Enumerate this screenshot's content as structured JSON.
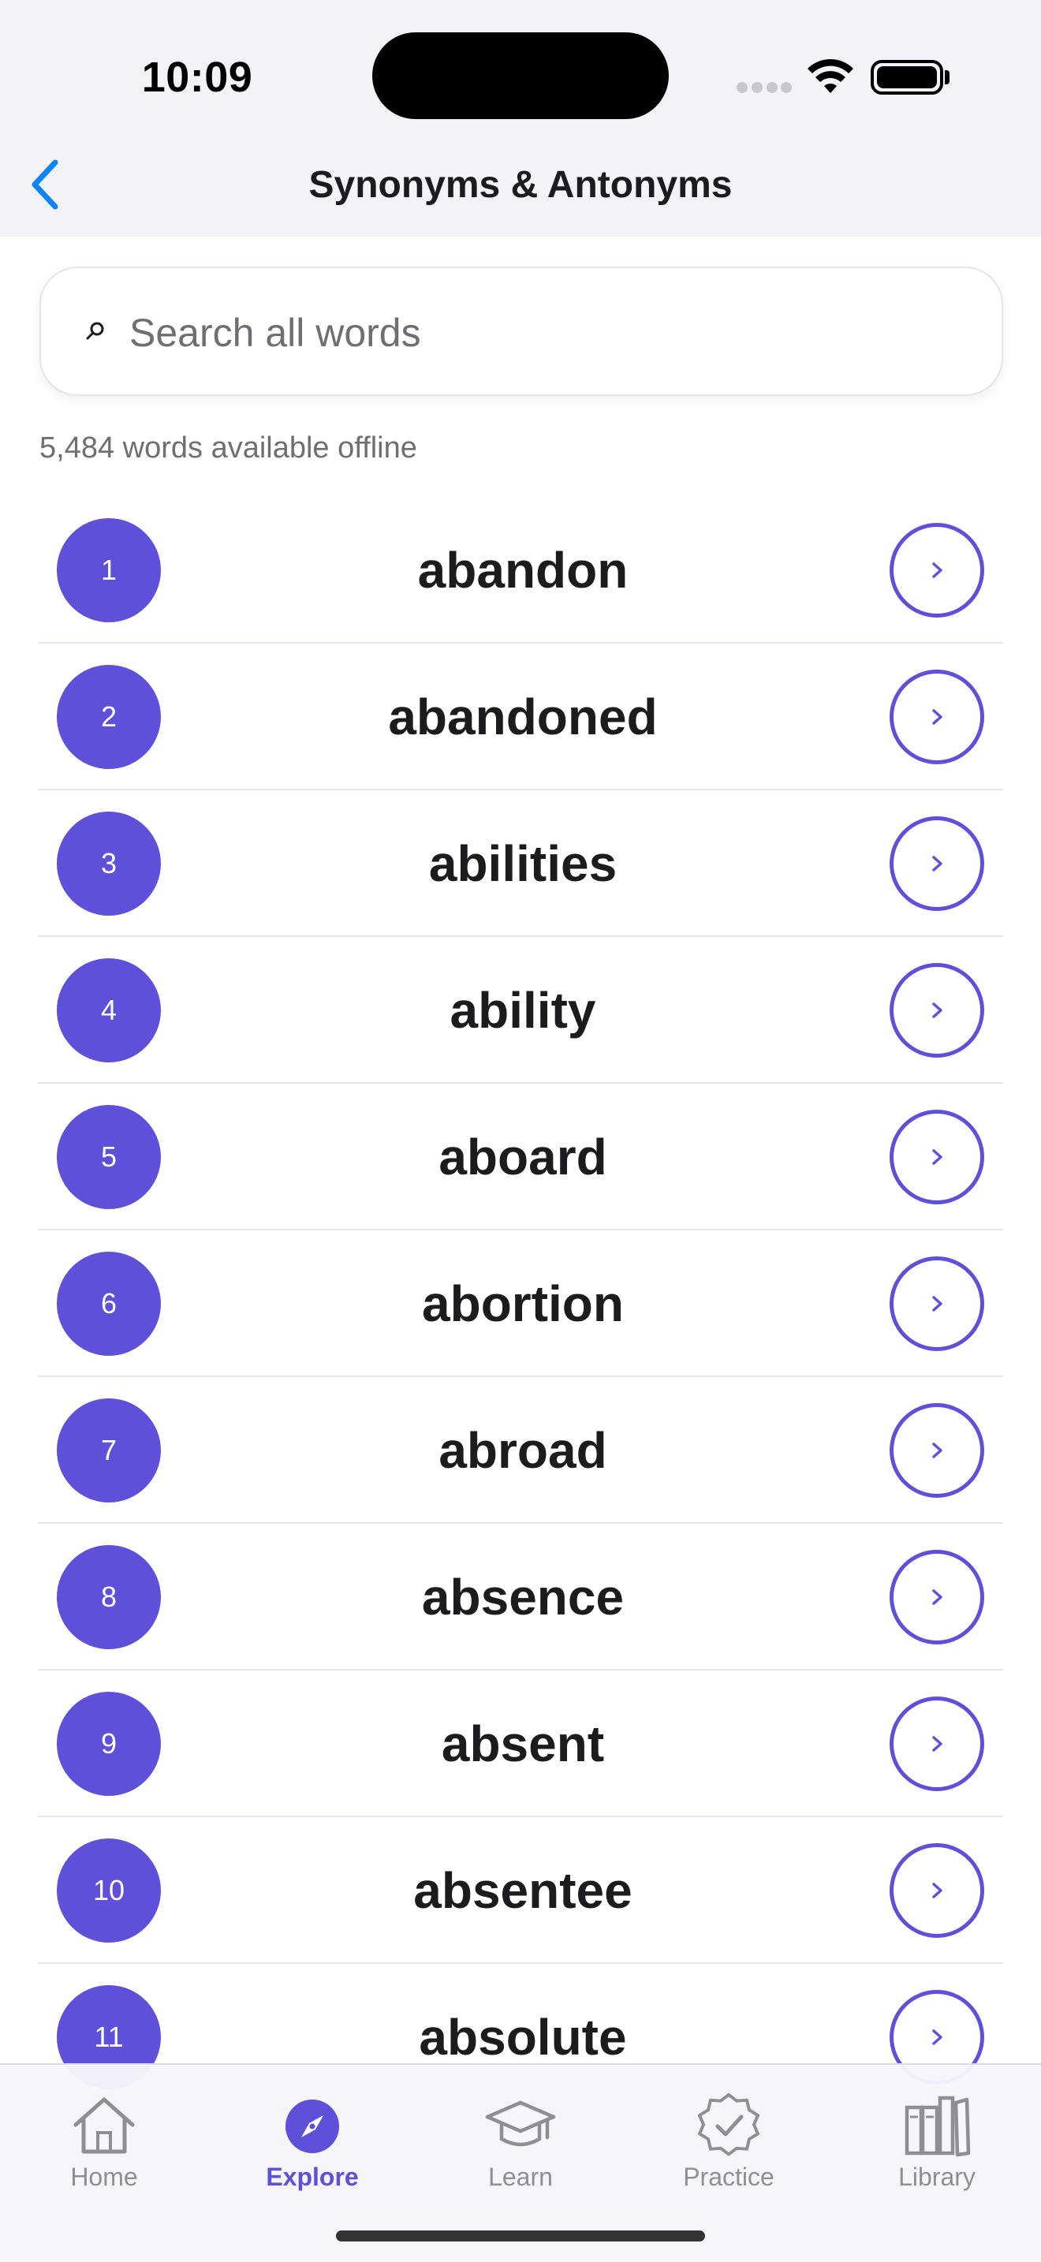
{
  "status_bar": {
    "time": "10:09"
  },
  "nav": {
    "title": "Synonyms & Antonyms",
    "back_icon": "chevron-left-icon"
  },
  "search": {
    "placeholder": "Search all words",
    "value": ""
  },
  "word_count_text": "5,484 words available offline",
  "words": [
    {
      "number": "1",
      "word": "abandon"
    },
    {
      "number": "2",
      "word": "abandoned"
    },
    {
      "number": "3",
      "word": "abilities"
    },
    {
      "number": "4",
      "word": "ability"
    },
    {
      "number": "5",
      "word": "aboard"
    },
    {
      "number": "6",
      "word": "abortion"
    },
    {
      "number": "7",
      "word": "abroad"
    },
    {
      "number": "8",
      "word": "absence"
    },
    {
      "number": "9",
      "word": "absent"
    },
    {
      "number": "10",
      "word": "absentee"
    },
    {
      "number": "11",
      "word": "absolute"
    }
  ],
  "tabs": [
    {
      "label": "Home",
      "icon": "house-icon",
      "active": false
    },
    {
      "label": "Explore",
      "icon": "compass-icon",
      "active": true
    },
    {
      "label": "Learn",
      "icon": "graduation-cap-icon",
      "active": false
    },
    {
      "label": "Practice",
      "icon": "check-badge-icon",
      "active": false
    },
    {
      "label": "Library",
      "icon": "books-icon",
      "active": false
    }
  ],
  "colors": {
    "accent": "#5e50d9",
    "back_arrow": "#0a84ff",
    "inactive_tab": "#8e8e93"
  }
}
